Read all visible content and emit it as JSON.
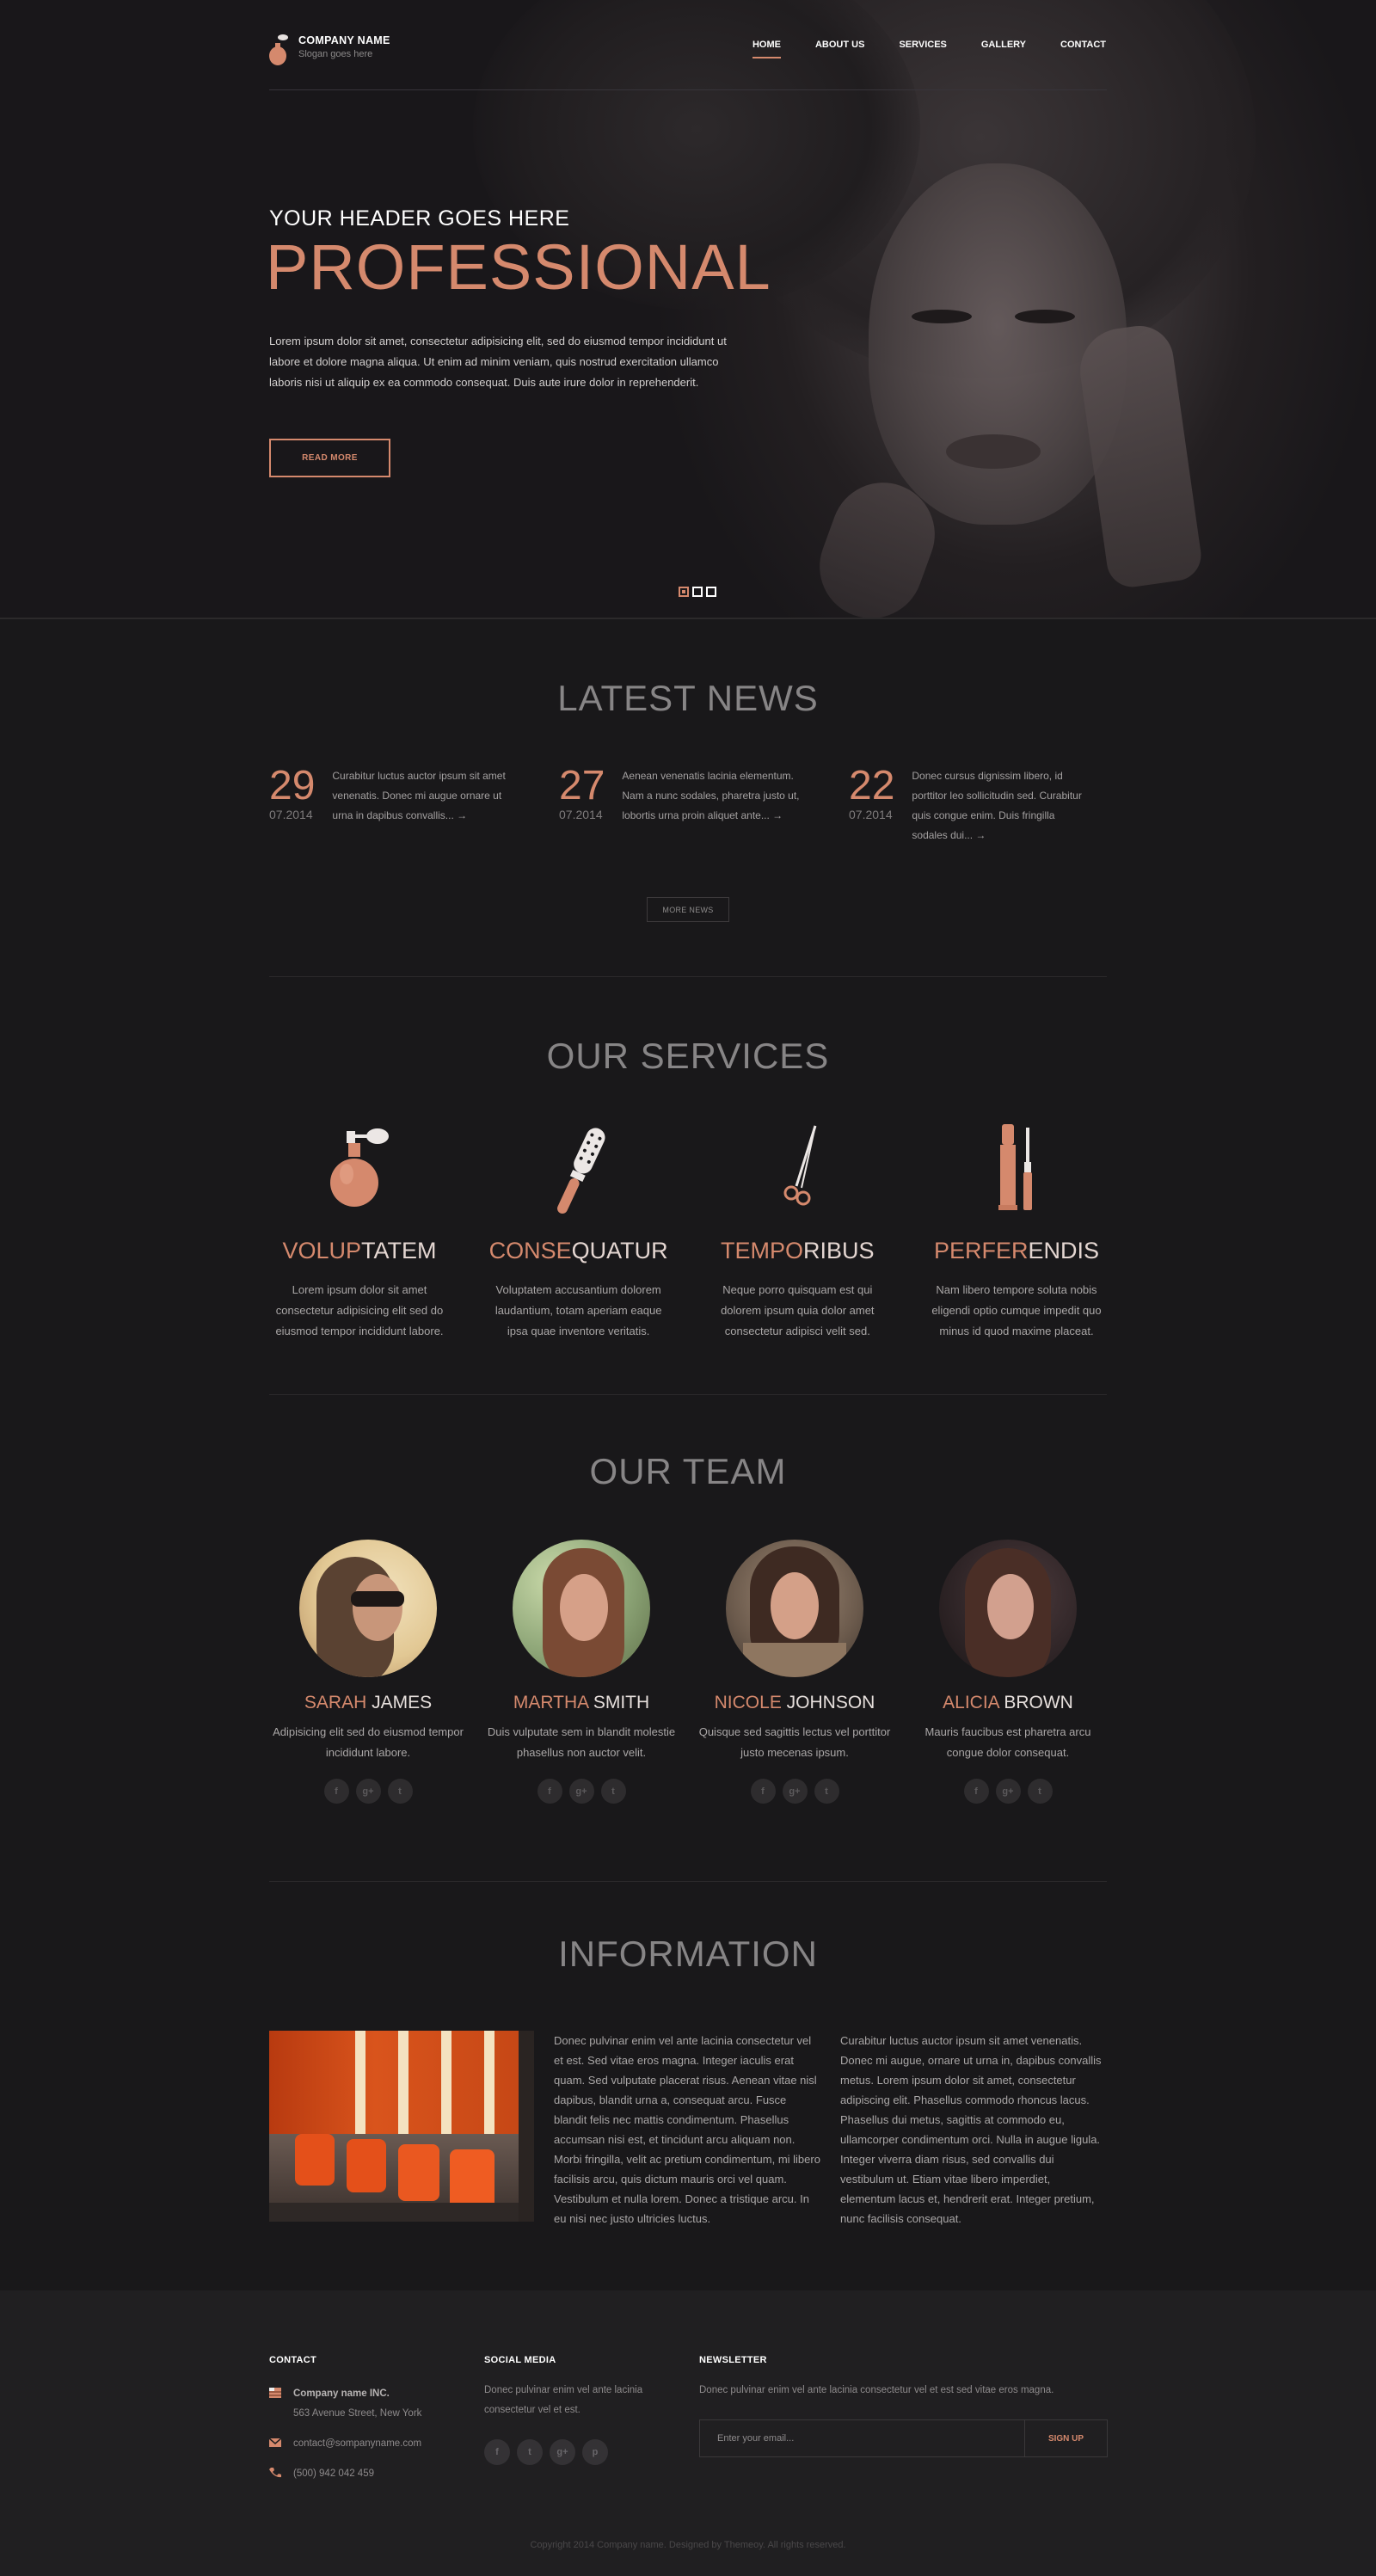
{
  "brand": {
    "company": "COMPANY NAME",
    "slogan": "Slogan goes here"
  },
  "nav": [
    {
      "label": "HOME",
      "active": true
    },
    {
      "label": "ABOUT US"
    },
    {
      "label": "SERVICES"
    },
    {
      "label": "GALLERY"
    },
    {
      "label": "CONTACT"
    }
  ],
  "hero": {
    "subheading": "YOUR HEADER GOES HERE",
    "title": "PROFESSIONAL",
    "text": "Lorem ipsum dolor sit amet, consectetur adipisicing elit, sed do eiusmod tempor incididunt ut labore et dolore magna aliqua. Ut enim ad minim veniam, quis nostrud exercitation ullamco laboris nisi ut aliquip ex ea commodo consequat. Duis aute irure dolor in reprehenderit.",
    "button": "READ MORE",
    "slides": 3,
    "active_slide": 1
  },
  "news": {
    "title": "LATEST NEWS",
    "items": [
      {
        "day": "29",
        "month": "07.2014",
        "text": "Curabitur luctus auctor ipsum sit amet venenatis. Donec mi augue ornare ut urna in dapibus convallis... →"
      },
      {
        "day": "27",
        "month": "07.2014",
        "text": "Aenean venenatis lacinia elementum. Nam a nunc sodales, pharetra justo ut, lobortis urna proin aliquet ante... →"
      },
      {
        "day": "22",
        "month": "07.2014",
        "text": "Donec cursus dignissim libero, id porttitor leo sollicitudin sed. Curabitur quis congue enim. Duis fringilla sodales dui... →"
      }
    ],
    "more_button": "MORE NEWS"
  },
  "services": {
    "title": "OUR SERVICES",
    "items": [
      {
        "title_accent": "VOLUP",
        "title_rest": "TATEM",
        "icon": "perfume-bottle-icon",
        "text": "Lorem ipsum dolor sit amet consectetur adipisicing elit sed do eiusmod tempor incididunt labore."
      },
      {
        "title_accent": "CONSE",
        "title_rest": "QUATUR",
        "icon": "hair-brush-icon",
        "text": "Voluptatem accusantium dolorem laudantium, totam aperiam eaque ipsa quae inventore veritatis."
      },
      {
        "title_accent": "TEMPO",
        "title_rest": "RIBUS",
        "icon": "scissors-icon",
        "text": "Neque porro quisquam est qui dolorem ipsum quia dolor amet consectetur adipisci velit sed."
      },
      {
        "title_accent": "PERFER",
        "title_rest": "ENDIS",
        "icon": "lipstick-mascara-icon",
        "text": "Nam libero tempore soluta nobis eligendi optio cumque impedit quo minus id quod maxime placeat."
      }
    ]
  },
  "team": {
    "title": "OUR TEAM",
    "members": [
      {
        "first": "SARAH",
        "last": "JAMES",
        "text": "Adipisicing elit sed do eiusmod tempor incididunt labore."
      },
      {
        "first": "MARTHA",
        "last": "SMITH",
        "text": "Duis vulputate sem in blandit molestie phasellus non auctor velit."
      },
      {
        "first": "NICOLE",
        "last": "JOHNSON",
        "text": "Quisque sed sagittis lectus vel porttitor justo mecenas ipsum."
      },
      {
        "first": "ALICIA",
        "last": "BROWN",
        "text": "Mauris faucibus est pharetra arcu congue dolor consequat."
      }
    ],
    "social_icons": [
      "facebook-icon",
      "google-plus-icon",
      "twitter-icon"
    ]
  },
  "information": {
    "title": "INFORMATION",
    "col1": "Donec pulvinar enim vel ante lacinia consectetur vel et est. Sed vitae eros magna. Integer iaculis erat quam. Sed vulputate placerat risus. Aenean vitae nisl dapibus, blandit urna a, consequat arcu. Fusce blandit felis nec mattis condimentum. Phasellus accumsan nisi est, et tincidunt arcu aliquam non. Morbi fringilla, velit ac pretium condimentum, mi libero facilisis arcu, quis dictum mauris orci vel quam. Vestibulum et nulla lorem. Donec a tristique arcu. In eu nisi nec justo ultricies luctus.",
    "col2": "Curabitur luctus auctor ipsum sit amet venenatis. Donec mi augue, ornare ut urna in, dapibus convallis metus. Lorem ipsum dolor sit amet, consectetur adipiscing elit. Phasellus commodo rhoncus lacus. Phasellus dui metus, sagittis at commodo eu, ullamcorper condimentum orci. Nulla in augue ligula. Integer viverra diam risus, sed convallis dui vestibulum ut. Etiam vitae libero imperdiet, elementum lacus et, hendrerit erat. Integer pretium, nunc facilisis consequat."
  },
  "footer": {
    "contact": {
      "title": "CONTACT",
      "company": "Company name INC.",
      "address": "563 Avenue Street, New York",
      "email": "contact@sompanyname.com",
      "phone": "(500) 942 042 459"
    },
    "social": {
      "title": "SOCIAL MEDIA",
      "text": "Donec pulvinar enim vel ante lacinia consectetur vel et est.",
      "icons": [
        "facebook-icon",
        "twitter-icon",
        "google-plus-icon",
        "pinterest-icon"
      ]
    },
    "newsletter": {
      "title": "NEWSLETTER",
      "text": "Donec pulvinar enim vel ante lacinia consectetur vel et est sed vitae eros magna.",
      "placeholder": "Enter your email...",
      "button": "SIGN UP"
    },
    "copyright": "Copyright 2014 Company name. Designed by Themeoy. All rights reserved."
  },
  "colors": {
    "accent": "#d5896d",
    "background": "#19181a",
    "footer": "#201f21"
  }
}
